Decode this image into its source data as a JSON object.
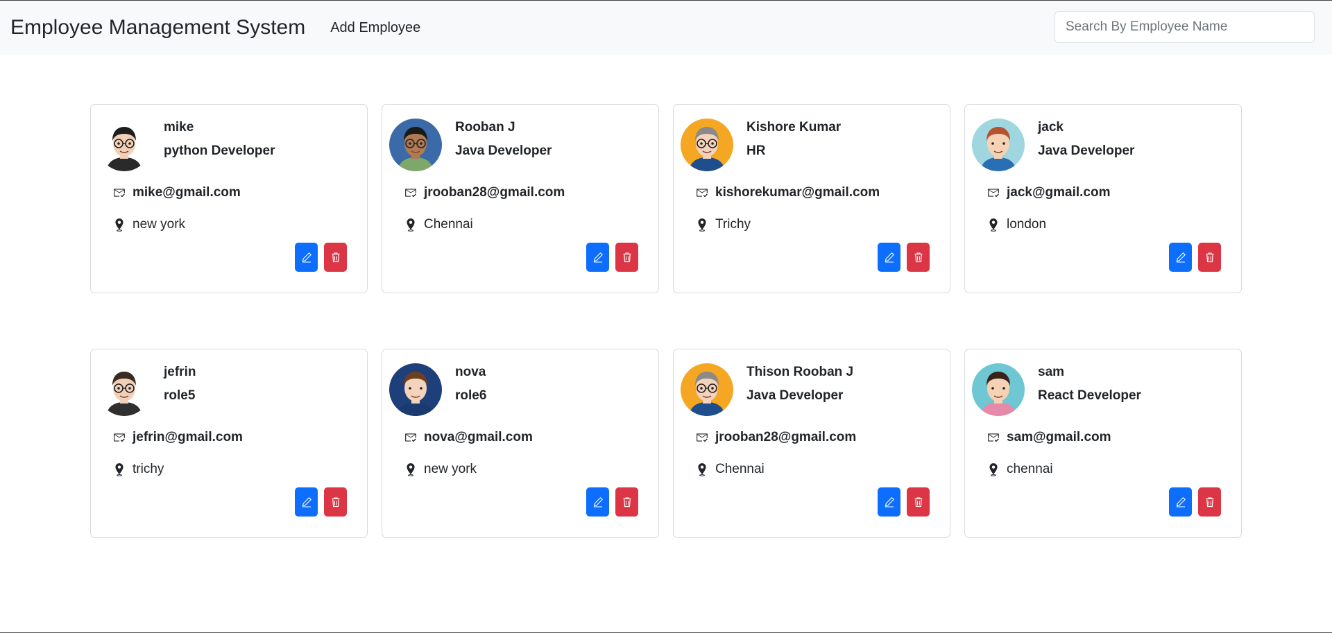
{
  "navbar": {
    "brand": "Employee Management System",
    "add_link": "Add Employee",
    "search_placeholder": "Search By Employee Name"
  },
  "employees": [
    {
      "name": "mike",
      "role": "python Developer",
      "email": "mike@gmail.com",
      "location": "new york",
      "avatar": {
        "bg": "#ffffff",
        "skin": "#f2d0b8",
        "hair": "#1e1e1e",
        "shirt": "#2a2a2a",
        "glasses": true
      }
    },
    {
      "name": "Rooban J",
      "role": "Java Developer",
      "email": "jrooban28@gmail.com",
      "location": "Chennai",
      "avatar": {
        "bg": "#3b6aa8",
        "skin": "#b07a52",
        "hair": "#1a1a1a",
        "shirt": "#7ea86a",
        "glasses": true
      }
    },
    {
      "name": "Kishore Kumar",
      "role": "HR",
      "email": "kishorekumar@gmail.com",
      "location": "Trichy",
      "avatar": {
        "bg": "#f5a623",
        "skin": "#f3d3bb",
        "hair": "#8a8a8a",
        "shirt": "#1f4e8c",
        "glasses": true
      }
    },
    {
      "name": "jack",
      "role": "Java Developer",
      "email": "jack@gmail.com",
      "location": "london",
      "avatar": {
        "bg": "#9fd6e0",
        "skin": "#f6d2b5",
        "hair": "#b5532e",
        "shirt": "#2a6fb3",
        "glasses": false
      }
    },
    {
      "name": "jefrin",
      "role": "role5",
      "email": "jefrin@gmail.com",
      "location": "trichy",
      "avatar": {
        "bg": "#ffffff",
        "skin": "#f2d0b8",
        "hair": "#3a2a22",
        "shirt": "#2f2f2f",
        "glasses": true
      }
    },
    {
      "name": "nova",
      "role": "role6",
      "email": "nova@gmail.com",
      "location": "new york",
      "avatar": {
        "bg": "#1f3f7a",
        "skin": "#f3d3bb",
        "hair": "#6b3f22",
        "shirt": "#1a3a70",
        "glasses": false
      }
    },
    {
      "name": "Thison Rooban J",
      "role": "Java Developer",
      "email": "jrooban28@gmail.com",
      "location": "Chennai",
      "avatar": {
        "bg": "#f5a623",
        "skin": "#f3d3bb",
        "hair": "#8a8a8a",
        "shirt": "#1f4e8c",
        "glasses": true
      }
    },
    {
      "name": "sam",
      "role": "React Developer",
      "email": "sam@gmail.com",
      "location": "chennai",
      "avatar": {
        "bg": "#6fc7d3",
        "skin": "#f6d2b5",
        "hair": "#3a2218",
        "shirt": "#e58aa8",
        "glasses": false
      }
    }
  ],
  "colors": {
    "edit_button": "#0d6efd",
    "delete_button": "#dc3545",
    "navbar_bg": "#f8f9fa"
  },
  "icons": {
    "email": "envelope-check-icon",
    "location": "geo-pin-icon",
    "edit": "pencil-icon",
    "delete": "trash-icon"
  }
}
